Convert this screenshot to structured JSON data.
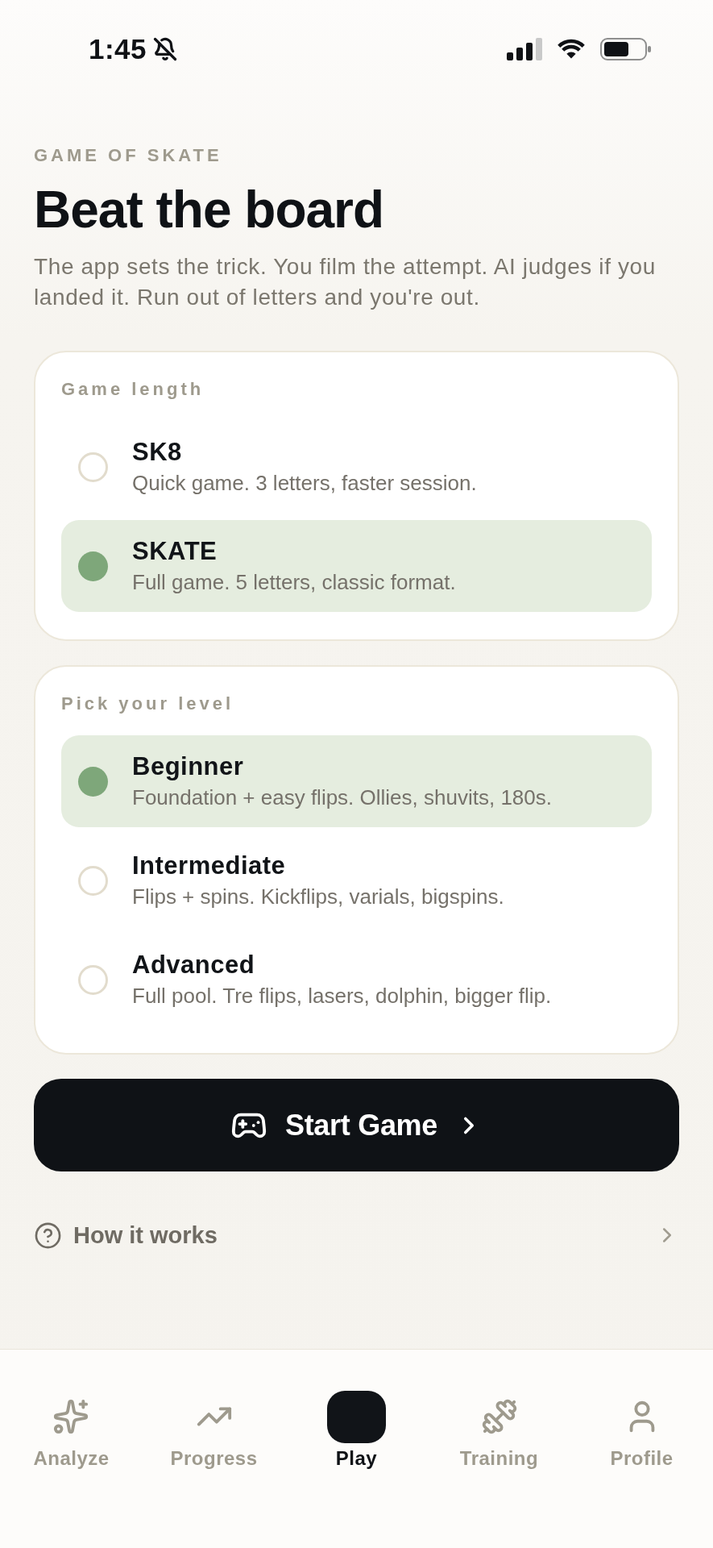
{
  "status_bar": {
    "time": "1:45"
  },
  "header": {
    "eyebrow": "GAME OF SKATE",
    "title": "Beat the board",
    "description": "The app sets the trick. You film the attempt. AI judges if you landed it. Run out of letters and you're out."
  },
  "sections": [
    {
      "label": "Game length",
      "options": [
        {
          "title": "SK8",
          "description": "Quick game. 3 letters, faster session.",
          "selected": false
        },
        {
          "title": "SKATE",
          "description": "Full game. 5 letters, classic format.",
          "selected": true
        }
      ]
    },
    {
      "label": "Pick your level",
      "options": [
        {
          "title": "Beginner",
          "description": "Foundation + easy flips. Ollies, shuvits, 180s.",
          "selected": true
        },
        {
          "title": "Intermediate",
          "description": "Flips + spins. Kickflips, varials, bigspins.",
          "selected": false
        },
        {
          "title": "Advanced",
          "description": "Full pool. Tre flips, lasers, dolphin, bigger flip.",
          "selected": false
        }
      ]
    }
  ],
  "start_button": {
    "label": "Start Game"
  },
  "help_link": {
    "label": "How it works"
  },
  "tab_bar": [
    {
      "label": "Analyze",
      "selected": false
    },
    {
      "label": "Progress",
      "selected": false
    },
    {
      "label": "Play",
      "selected": true
    },
    {
      "label": "Training",
      "selected": false
    },
    {
      "label": "Profile",
      "selected": false
    }
  ]
}
